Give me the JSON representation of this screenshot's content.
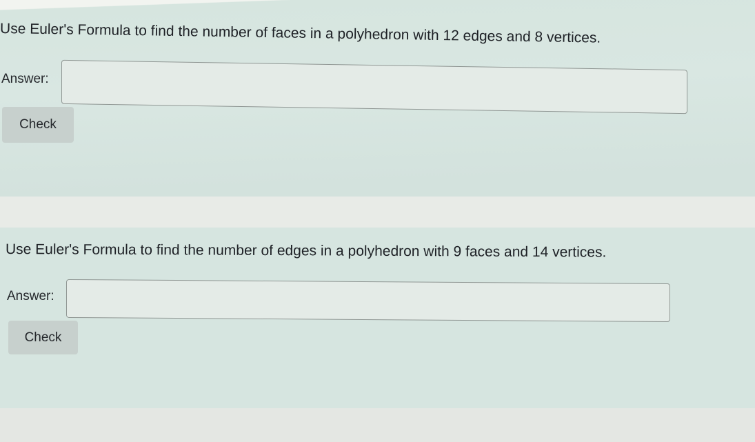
{
  "questions": [
    {
      "prompt": "Use Euler's Formula to find the number of faces in a polyhedron with 12 edges and 8 vertices.",
      "answer_label": "Answer:",
      "answer_value": "",
      "check_label": "Check"
    },
    {
      "prompt": "Use Euler's Formula to find the number of edges in a polyhedron with 9 faces and 14 vertices.",
      "answer_label": "Answer:",
      "answer_value": "",
      "check_label": "Check"
    }
  ],
  "colors": {
    "card_background": "#d6e5e0",
    "page_background": "#e6e9e5",
    "button_background": "#c7d0cd",
    "text": "#1e2126"
  }
}
